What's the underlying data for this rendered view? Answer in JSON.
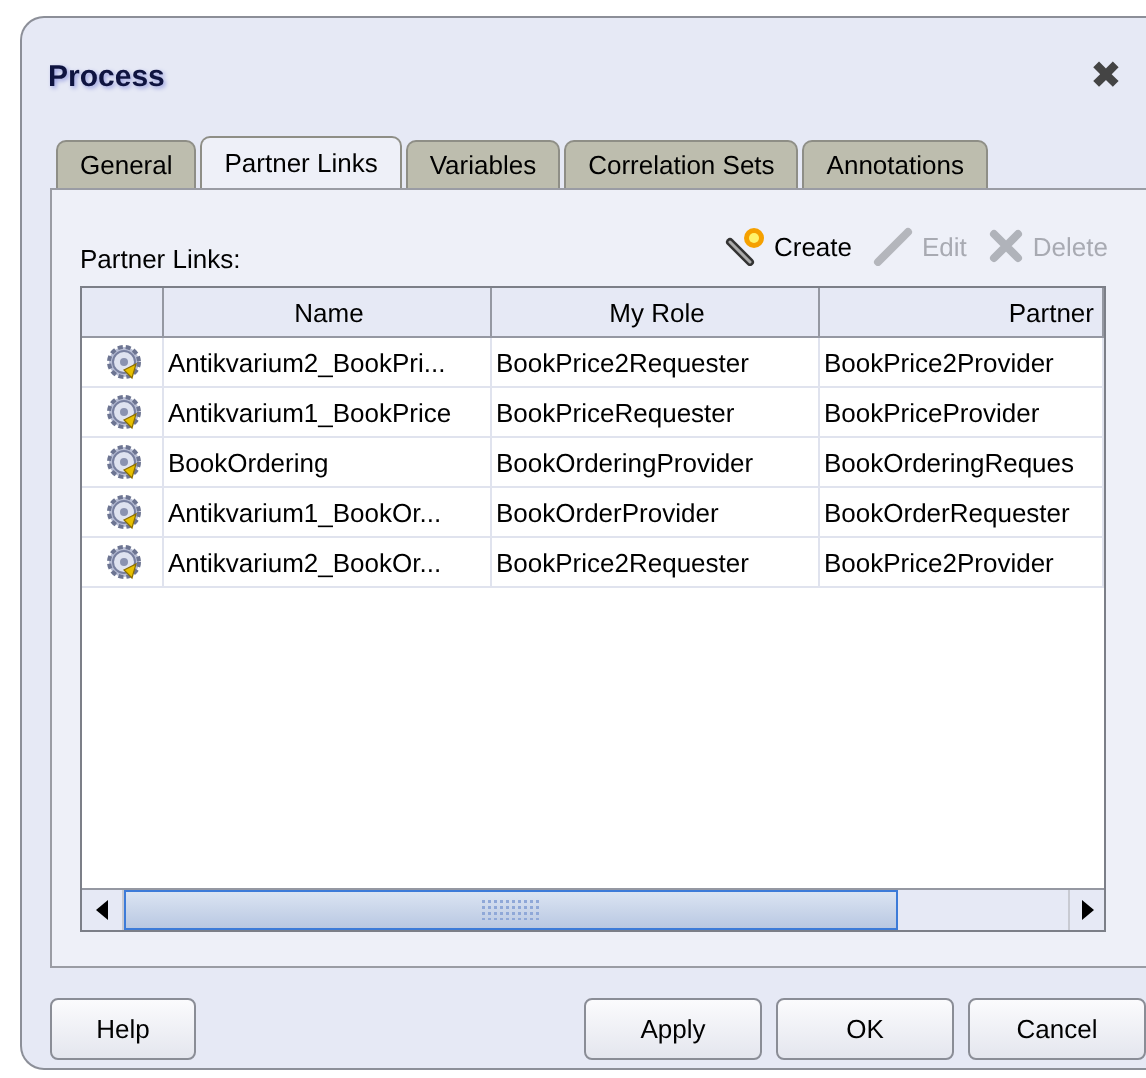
{
  "window": {
    "title": "Process",
    "close": "✖"
  },
  "tabs": [
    {
      "label": "General",
      "selected": false
    },
    {
      "label": "Partner Links",
      "selected": true
    },
    {
      "label": "Variables",
      "selected": false
    },
    {
      "label": "Correlation Sets",
      "selected": false
    },
    {
      "label": "Annotations",
      "selected": false
    }
  ],
  "section_label": "Partner Links:",
  "toolbar": [
    {
      "kind": "create",
      "label": "Create",
      "disabled": false
    },
    {
      "kind": "edit",
      "label": "Edit",
      "disabled": true
    },
    {
      "kind": "delete",
      "label": "Delete",
      "disabled": true
    }
  ],
  "table": {
    "columns": [
      "Name",
      "My Role",
      "Partner"
    ],
    "rows": [
      [
        "Antikvarium2_BookPri...",
        "BookPrice2Requester",
        "BookPrice2Provider"
      ],
      [
        "Antikvarium1_BookPrice",
        "BookPriceRequester",
        "BookPriceProvider"
      ],
      [
        "BookOrdering",
        "BookOrderingProvider",
        "BookOrderingReques"
      ],
      [
        "Antikvarium1_BookOr...",
        "BookOrderProvider",
        "BookOrderRequester"
      ],
      [
        "Antikvarium2_BookOr...",
        "BookPrice2Requester",
        "BookPrice2Provider"
      ]
    ]
  },
  "buttons": [
    "Help",
    "Apply",
    "OK",
    "Cancel"
  ]
}
